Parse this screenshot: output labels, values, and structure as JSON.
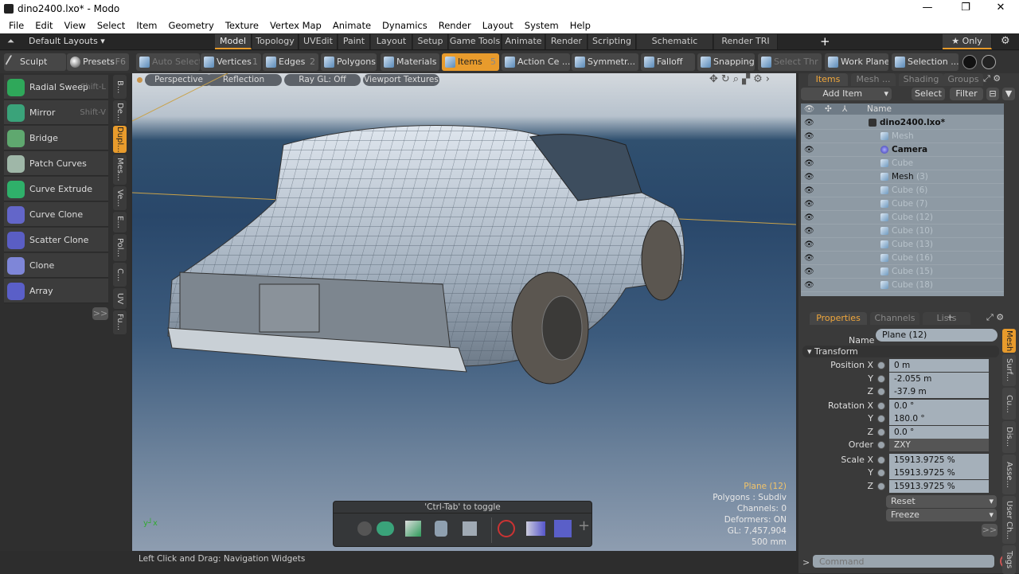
{
  "window": {
    "title": "dino2400.lxo* - Modo",
    "minimize": "—",
    "maximize": "❐",
    "close": "✕"
  },
  "menu": [
    "File",
    "Edit",
    "View",
    "Select",
    "Item",
    "Geometry",
    "Texture",
    "Vertex Map",
    "Animate",
    "Dynamics",
    "Render",
    "Layout",
    "System",
    "Help"
  ],
  "layouts": {
    "selector": "Default Layouts ▾",
    "tabs": [
      "Model",
      "Topology",
      "UVEdit",
      "Paint",
      "Layout",
      "Setup",
      "Game Tools",
      "Animate",
      "Render",
      "Scripting",
      "Schematic Fusion",
      "Render TRI"
    ],
    "active": "Model",
    "add": "+",
    "only": "★ Only"
  },
  "toolbar": {
    "sculpt": "Sculpt",
    "presets": "Presets",
    "presets_key": "F6",
    "buttons": [
      {
        "label": "Auto Select",
        "key": "",
        "state": "dim"
      },
      {
        "label": "Vertices",
        "key": "1",
        "state": ""
      },
      {
        "label": "Edges",
        "key": "2",
        "state": ""
      },
      {
        "label": "Polygons",
        "key": "",
        "state": ""
      },
      {
        "label": "Materials",
        "key": "",
        "state": ""
      },
      {
        "label": "Items",
        "key": "5",
        "state": "active"
      },
      {
        "label": "Action Ce ...",
        "key": "",
        "state": ""
      },
      {
        "label": "Symmetr...",
        "key": "",
        "state": ""
      },
      {
        "label": "Falloff",
        "key": "",
        "state": ""
      },
      {
        "label": "Snapping",
        "key": "",
        "state": ""
      },
      {
        "label": "Select Thr ...",
        "key": "",
        "state": "dim"
      },
      {
        "label": "Work Plane",
        "key": "",
        "state": ""
      },
      {
        "label": "Selection ...",
        "key": "",
        "state": ""
      }
    ]
  },
  "tools": [
    {
      "label": "Radial Sweep",
      "shortcut": "Shift-L",
      "color": "#2fa85a"
    },
    {
      "label": "Mirror",
      "shortcut": "Shift-V",
      "color": "#3aa37a"
    },
    {
      "label": "Bridge",
      "shortcut": "",
      "color": "#5fa86f"
    },
    {
      "label": "Patch Curves",
      "shortcut": "",
      "color": "#9fb7a8"
    },
    {
      "label": "Curve Extrude",
      "shortcut": "",
      "color": "#2fb06a"
    },
    {
      "label": "Curve Clone",
      "shortcut": "",
      "color": "#6366c9"
    },
    {
      "label": "Scatter Clone",
      "shortcut": "",
      "color": "#5a5ec4"
    },
    {
      "label": "Clone",
      "shortcut": "",
      "color": "#7e86d8"
    },
    {
      "label": "Array",
      "shortcut": "",
      "color": "#5a5fc8"
    }
  ],
  "more": ">>",
  "left_vtabs": [
    "B...",
    "De...",
    "Dupl...",
    "Mes...",
    "Ve...",
    "E...",
    "Pol...",
    "C...",
    "UV",
    "Fu..."
  ],
  "left_vtab_active": "Dupl...",
  "viewport": {
    "buttons": [
      "Perspective",
      "Reflection",
      "Ray GL: Off",
      "Viewport Textures"
    ],
    "info": {
      "item": "Plane (12)",
      "polygons": "Polygons : Subdiv",
      "channels": "Channels: 0",
      "deformers": "Deformers: ON",
      "gl": "GL: 7,457,904",
      "scale": "500 mm"
    },
    "pie_title": "'Ctrl-Tab' to toggle",
    "pie_add": "+"
  },
  "status": "Left Click and Drag:  Navigation Widgets",
  "items_panel": {
    "tabs": [
      "Items",
      "Mesh ...",
      "Shading",
      "Groups"
    ],
    "active": "Items",
    "add_item": "Add Item",
    "select": "Select",
    "filter": "Filter",
    "name_col": "Name",
    "tree": [
      {
        "name": "dino2400.lxo*",
        "suffix": "",
        "style": "bold",
        "indent": 0,
        "kind": "scene"
      },
      {
        "name": "Mesh",
        "suffix": "",
        "style": "dim",
        "indent": 1,
        "kind": "mesh"
      },
      {
        "name": "Camera",
        "suffix": "",
        "style": "bold",
        "indent": 1,
        "kind": "camera"
      },
      {
        "name": "Cube",
        "suffix": "",
        "style": "dim",
        "indent": 1,
        "kind": "mesh"
      },
      {
        "name": "Mesh",
        "suffix": "(3)",
        "style": "on",
        "indent": 1,
        "kind": "mesh"
      },
      {
        "name": "Cube",
        "suffix": "(6)",
        "style": "dim",
        "indent": 1,
        "kind": "mesh"
      },
      {
        "name": "Cube",
        "suffix": "(7)",
        "style": "dim",
        "indent": 1,
        "kind": "mesh"
      },
      {
        "name": "Cube",
        "suffix": "(12)",
        "style": "dim",
        "indent": 1,
        "kind": "mesh"
      },
      {
        "name": "Cube",
        "suffix": "(10)",
        "style": "dim",
        "indent": 1,
        "kind": "mesh"
      },
      {
        "name": "Cube",
        "suffix": "(13)",
        "style": "dim",
        "indent": 1,
        "kind": "mesh"
      },
      {
        "name": "Cube",
        "suffix": "(16)",
        "style": "dim",
        "indent": 1,
        "kind": "mesh"
      },
      {
        "name": "Cube",
        "suffix": "(15)",
        "style": "dim",
        "indent": 1,
        "kind": "mesh"
      },
      {
        "name": "Cube",
        "suffix": "(18)",
        "style": "dim",
        "indent": 1,
        "kind": "mesh"
      }
    ]
  },
  "properties": {
    "tabs": [
      "Properties",
      "Channels",
      "Lists"
    ],
    "active": "Properties",
    "add": "+",
    "name_label": "Name",
    "name_value": "Plane (12)",
    "section": "Transform",
    "rows": [
      {
        "label": "Position X",
        "value": "0 m"
      },
      {
        "label": "Y",
        "value": "-2.055 m"
      },
      {
        "label": "Z",
        "value": "-37.9 m"
      },
      {
        "label": "Rotation X",
        "value": "0.0 °"
      },
      {
        "label": "Y",
        "value": "180.0 °"
      },
      {
        "label": "Z",
        "value": "0.0 °"
      },
      {
        "label": "Order",
        "value": "ZXY"
      },
      {
        "label": "Scale X",
        "value": "15913.9725 %"
      },
      {
        "label": "Y",
        "value": "15913.9725 %"
      },
      {
        "label": "Z",
        "value": "15913.9725 %"
      }
    ],
    "reset": "Reset",
    "freeze": "Freeze",
    "more": ">>",
    "vtabs": [
      "Mesh",
      "Surf...",
      "Cu...",
      "Dis...",
      "Asse...",
      "User Ch...",
      "Tags"
    ],
    "vtab_active": "Mesh"
  },
  "command": {
    "prompt": ">",
    "placeholder": "Command"
  },
  "colors": {
    "accent": "#e89b2c",
    "viewport_bg": "#29476a"
  }
}
